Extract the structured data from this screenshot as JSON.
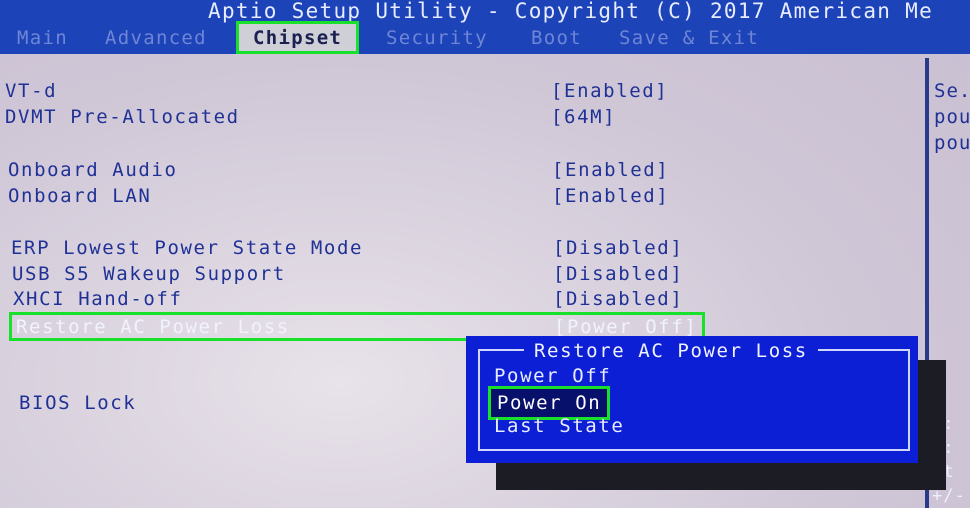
{
  "header": {
    "title": "Aptio Setup Utility - Copyright (C) 2017 American Me",
    "tabs": [
      "Main",
      "Advanced",
      "Chipset",
      "Security",
      "Boot",
      "Save & Exit"
    ],
    "active_tab": "Chipset"
  },
  "settings": [
    {
      "label": "VT-d",
      "value": "[Enabled]"
    },
    {
      "label": "DVMT Pre-Allocated",
      "value": "[64M]"
    },
    {
      "label": "Onboard Audio",
      "value": "[Enabled]"
    },
    {
      "label": "Onboard LAN",
      "value": "[Enabled]"
    },
    {
      "label": "ERP Lowest Power State Mode",
      "value": "[Disabled]"
    },
    {
      "label": "USB S5 Wakeup Support",
      "value": "[Disabled]"
    },
    {
      "label": "XHCI Hand-off",
      "value": "[Disabled]"
    },
    {
      "label": "Restore AC Power Loss",
      "value": "[Power Off]"
    },
    {
      "label": "BIOS Lock",
      "value": ""
    }
  ],
  "help_panel": {
    "lines": [
      "Se.",
      "pou",
      "pou"
    ],
    "key_hints": [
      "←:",
      "↑:",
      "nt",
      "+/-"
    ]
  },
  "popup": {
    "title": "Restore AC Power Loss",
    "options": [
      "Power Off",
      "Power On",
      "Last State"
    ],
    "selected": "Power On"
  },
  "colors": {
    "accent_highlight": "#19e02a",
    "header_blue": "#1d43b8",
    "popup_blue": "#0d1fd4",
    "text_blue": "#203196"
  }
}
